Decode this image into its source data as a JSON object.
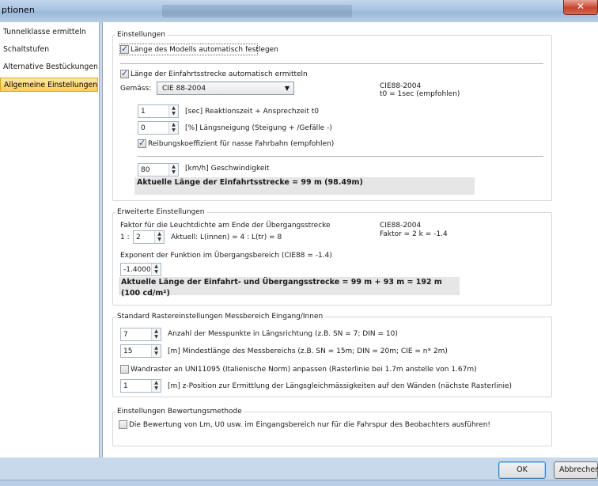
{
  "window": {
    "title": "ptionen",
    "close_label": "✕"
  },
  "sidebar": {
    "items": [
      {
        "label": "Tunnelklasse ermitteln"
      },
      {
        "label": "Schaltstufen"
      },
      {
        "label": "Alternative Bestückungen"
      },
      {
        "label": "Allgemeine Einstellungen"
      }
    ]
  },
  "einstellungen": {
    "title": "Einstellungen",
    "auto_length_label": "Länge des Modells automatisch festlegen",
    "auto_entry_label": "Länge der Einfahrtsstrecke automatisch ermitteln",
    "gemaess_label": "Gemäss:",
    "gemaess_value": "CIE 88-2004",
    "note_line1": "CIE88-2004",
    "note_line2": "t0 = 1sec (empfohlen)",
    "reaction_value": "1",
    "reaction_label": "[sec] Reaktionszeit + Ansprechzeit t0",
    "slope_value": "0",
    "slope_label": "[%] Längsneigung (Steigung + /Gefälle -)",
    "friction_label": "Reibungskoeffizient für nasse Fahrbahn (empfohlen)",
    "speed_value": "80",
    "speed_label": "[km/h] Geschwindigkeit",
    "result": "Aktuelle Länge der Einfahrtsstrecke = 99 m (98.49m)"
  },
  "erweiterte": {
    "title": "Erweiterte Einstellungen",
    "factor_label": "Faktor für die Leuchtdichte am Ende der Übergangsstrecke",
    "note_line1": "CIE88-2004",
    "note_line2": "Faktor = 2 k = -1.4",
    "ratio_prefix": "1 :",
    "ratio_value": "2",
    "ratio_text": "Aktuell:  L(innen) = 4 : L(tr) = 8",
    "exponent_label": "Exponent der Funktion im Übergangsbereich (CIE88 = -1.4)",
    "exponent_value": "-1.40000",
    "result": "Aktuelle Länge der Einfahrt- und Übergangsstrecke = 99 m + 93 m = 192 m (100 cd/m²)"
  },
  "raster": {
    "title": "Standard Rastereinstellungen Messbereich Eingang/Innen",
    "points_value": "7",
    "points_label": "Anzahl der Messpunkte in Längsrichtung (z.B. SN = 7; DIN = 10)",
    "minlen_value": "15",
    "minlen_label": "[m] Mindestlänge des Messbereichs (z.B. SN = 15m; DIN = 20m; CIE = n* 2m)",
    "wall_label": "Wandraster an UNI11095 (Italienische Norm) anpassen (Rasterlinie bei 1.7m anstelle von 1.67m)",
    "zpos_value": "1",
    "zpos_label": "[m] z-Position zur Ermittlung der Längsgleichmässigkeiten auf den Wänden (nächste Rasterlinie)"
  },
  "bewertung": {
    "title": "Einstellungen Bewertungsmethode",
    "label": "Die Bewertung von Lm, U0 usw. im Eingangsbereich nur für die Fahrspur des Beobachters ausführen!"
  },
  "buttons": {
    "ok": "OK",
    "cancel": "Abbrechen"
  },
  "colors": {
    "active_nav": "#fbcd57",
    "result_bg": "#e6e6e6",
    "titlebar": "#a9c3e2"
  }
}
